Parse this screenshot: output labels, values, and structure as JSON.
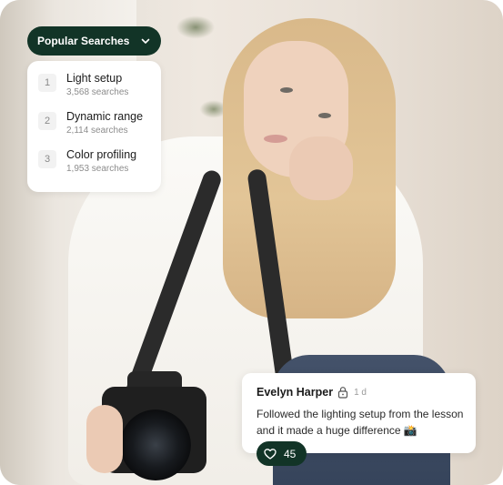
{
  "popular_searches": {
    "title": "Popular Searches",
    "items": [
      {
        "rank": "1",
        "label": "Light setup",
        "count": "3,568 searches"
      },
      {
        "rank": "2",
        "label": "Dynamic range",
        "count": "2,114 searches"
      },
      {
        "rank": "3",
        "label": "Color profiling",
        "count": "1,953 searches"
      }
    ]
  },
  "comment": {
    "author": "Evelyn Harper",
    "time": "1 d",
    "text": "Followed the lighting setup from the lesson and it made a huge difference 📸",
    "likes": "45"
  },
  "colors": {
    "accent_dark_green": "#123427",
    "card_bg": "#ffffff"
  },
  "icons": [
    "chevron-down-icon",
    "lock-icon",
    "heart-icon"
  ]
}
